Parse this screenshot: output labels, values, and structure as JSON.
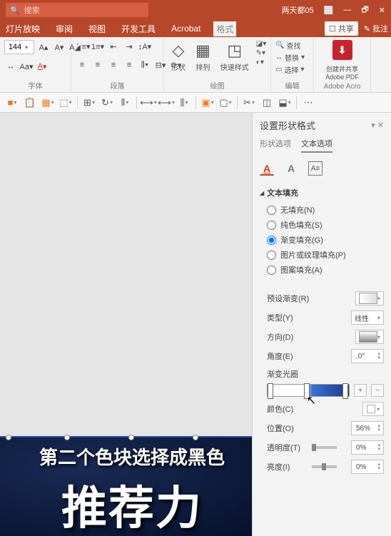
{
  "titlebar": {
    "search_placeholder": "搜索",
    "user": "两天都05",
    "window_btns": [
      "⬜",
      "—",
      "🗗",
      "✕"
    ]
  },
  "ribbon": {
    "tabs": [
      "灯片放映",
      "审阅",
      "视图",
      "开发工具",
      "Acrobat",
      "格式"
    ],
    "share": "共享",
    "annotate": "批注",
    "font_size": "144",
    "groups": {
      "font": "字体",
      "paragraph": "段落",
      "drawing": "绘图",
      "editing": "编辑",
      "adobe": "Adobe Acro"
    },
    "shape_btn": "形状",
    "arrange_btn": "排列",
    "quickstyle_btn": "快速样式",
    "find": "查找",
    "replace": "替换",
    "select": "选择",
    "adobe_btn": "创建并共享\nAdobe PDF"
  },
  "pane": {
    "title": "设置形状格式",
    "tabs": [
      "形状选项",
      "文本选项"
    ],
    "section_title": "文本填充",
    "radios": {
      "none": "无填充(N)",
      "solid": "纯色填充(S)",
      "gradient": "渐变填充(G)",
      "picture": "图片或纹理填充(P)",
      "pattern": "图案填充(A)"
    },
    "props": {
      "preset": "预设渐变(R)",
      "type": "类型(Y)",
      "type_value": "线性",
      "direction": "方向(D)",
      "angle": "角度(E)",
      "angle_value": ".0°",
      "stops": "渐变光圈",
      "color": "颜色(C)",
      "position": "位置(O)",
      "position_value": "56%",
      "transparency": "透明度(T)",
      "transparency_value": "0%",
      "brightness": "亮度(I)",
      "brightness_value": "0%"
    }
  },
  "caption": {
    "line1": "第二个色块选择成黑色",
    "line2": "推荐力"
  }
}
